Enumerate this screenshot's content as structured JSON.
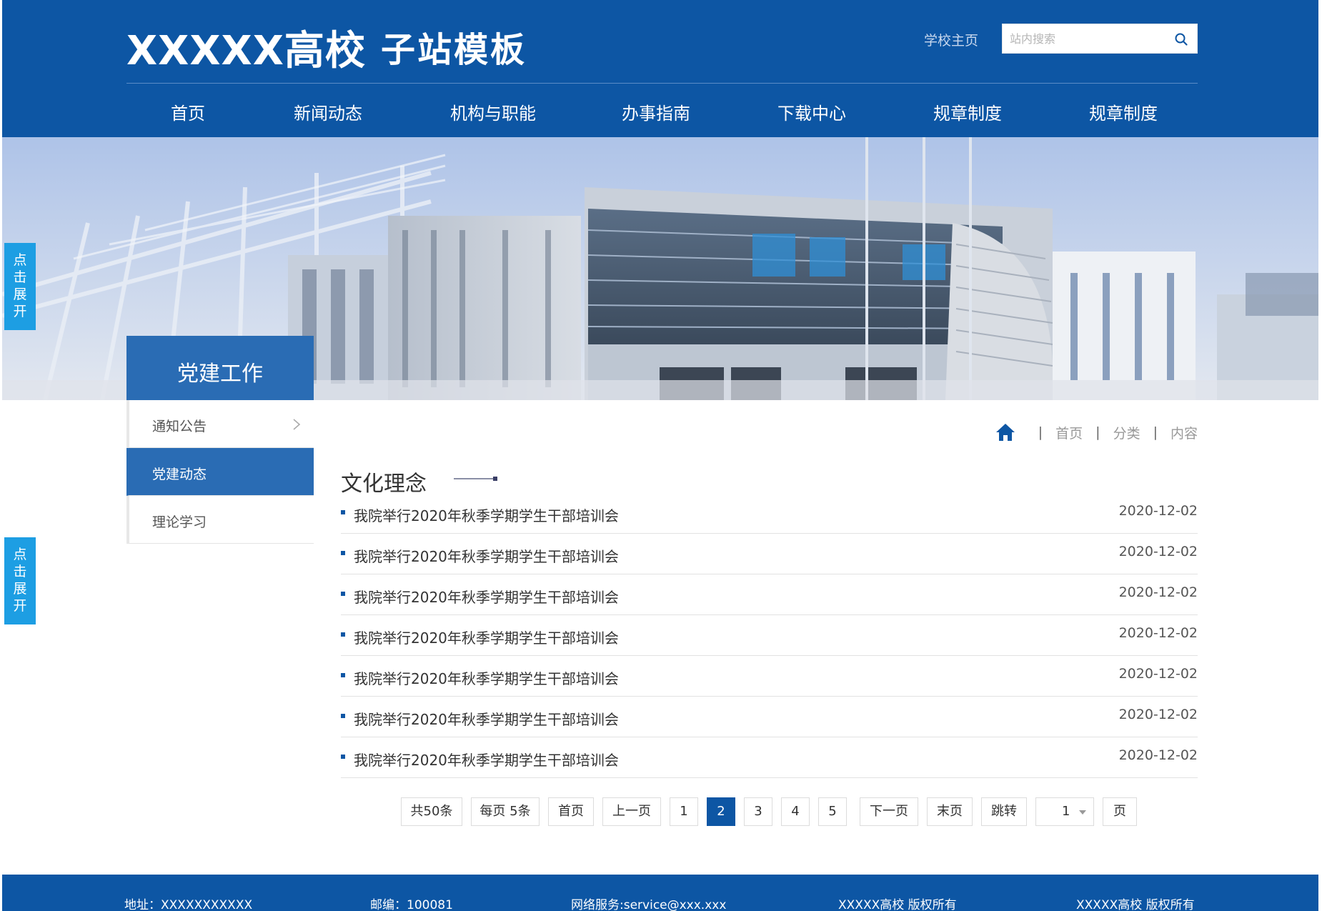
{
  "header": {
    "logo_main": "XXXXX高校",
    "logo_sub": "子站模板",
    "school_home": "学校主页",
    "search_placeholder": "站内搜索"
  },
  "nav": [
    "首页",
    "新闻动态",
    "机构与职能",
    "办事指南",
    "下载中心",
    "规章制度",
    "规章制度"
  ],
  "section_title": "党建工作",
  "float_button": [
    "点",
    "击",
    "展",
    "开"
  ],
  "sidebar": [
    {
      "label": "通知公告",
      "active": false
    },
    {
      "label": "党建动态",
      "active": true
    },
    {
      "label": "理论学习",
      "active": false
    }
  ],
  "breadcrumb": [
    "首页",
    "分类",
    "内容"
  ],
  "content_title": "文化理念",
  "news": [
    {
      "title": "我院举行2020年秋季学期学生干部培训会",
      "date": "2020-12-02"
    },
    {
      "title": "我院举行2020年秋季学期学生干部培训会",
      "date": "2020-12-02"
    },
    {
      "title": "我院举行2020年秋季学期学生干部培训会",
      "date": "2020-12-02"
    },
    {
      "title": "我院举行2020年秋季学期学生干部培训会",
      "date": "2020-12-02"
    },
    {
      "title": "我院举行2020年秋季学期学生干部培训会",
      "date": "2020-12-02"
    },
    {
      "title": "我院举行2020年秋季学期学生干部培训会",
      "date": "2020-12-02"
    },
    {
      "title": "我院举行2020年秋季学期学生干部培训会",
      "date": "2020-12-02"
    }
  ],
  "pager": {
    "total": "共50条",
    "per_page": "每页 5条",
    "first": "首页",
    "prev": "上一页",
    "pages": [
      "1",
      "2",
      "3",
      "4",
      "5"
    ],
    "current": "2",
    "next": "下一页",
    "last": "末页",
    "jump": "跳转",
    "select_value": "1",
    "page_suffix": "页"
  },
  "footer": {
    "address": "地址：XXXXXXXXXXX",
    "postcode": "邮编：100081",
    "service": "网络服务:service@xxx.xxx",
    "copyright1": "XXXXX高校 版权所有",
    "copyright2": "XXXXX高校 版权所有"
  },
  "colors": {
    "brand": "#0d56a4",
    "active": "#2a6cb4",
    "float": "#1d9ee3"
  }
}
